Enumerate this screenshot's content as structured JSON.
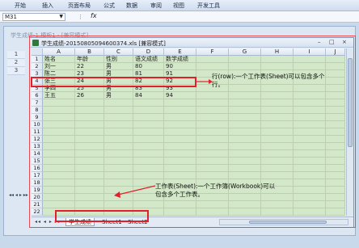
{
  "ribbon": {
    "tabs": [
      "开始",
      "插入",
      "页面布局",
      "公式",
      "数据",
      "审阅",
      "视图",
      "开发工具"
    ]
  },
  "formula_bar": {
    "name_box": "M31",
    "fx_label": "fx",
    "formula_value": ""
  },
  "background_window": {
    "title": "学生成绩-1.模板1 - [兼容模式]",
    "row_numbers": [
      "1",
      "2",
      "3"
    ]
  },
  "workbook_window": {
    "title": "学生成绩-20150805094600374.xls [兼容模式]",
    "buttons": [
      "–",
      "□",
      "×"
    ]
  },
  "grid": {
    "columns": [
      "A",
      "B",
      "C",
      "D",
      "E",
      "F",
      "G",
      "H",
      "I",
      "J"
    ],
    "rows": [
      "1",
      "2",
      "3",
      "4",
      "5",
      "6",
      "7",
      "8",
      "9",
      "10",
      "11",
      "12",
      "13",
      "14",
      "15",
      "16",
      "17",
      "18",
      "19",
      "20",
      "21",
      "22"
    ],
    "data": [
      [
        "姓名",
        "年龄",
        "性别",
        "语文成绩",
        "数学成绩"
      ],
      [
        "刘一",
        "22",
        "男",
        "80",
        "90"
      ],
      [
        "陈二",
        "23",
        "男",
        "81",
        "91"
      ],
      [
        "张三",
        "24",
        "男",
        "82",
        "92"
      ],
      [
        "李四",
        "25",
        "男",
        "83",
        "93"
      ],
      [
        "王五",
        "26",
        "男",
        "84",
        "94"
      ]
    ]
  },
  "annotations": {
    "row_note": "行(row):一个工作表(Sheet)可以包含多个行。",
    "sheet_note": "工作表(Sheet):一个工作簿(Workbook)可以包含多个工作表。"
  },
  "sheet_tabs": {
    "nav": "◂◂ ◂ ▸ ▸▸",
    "tabs": [
      "学生成绩",
      "Sheet1",
      "Sheet2"
    ],
    "active": "学生成绩"
  }
}
